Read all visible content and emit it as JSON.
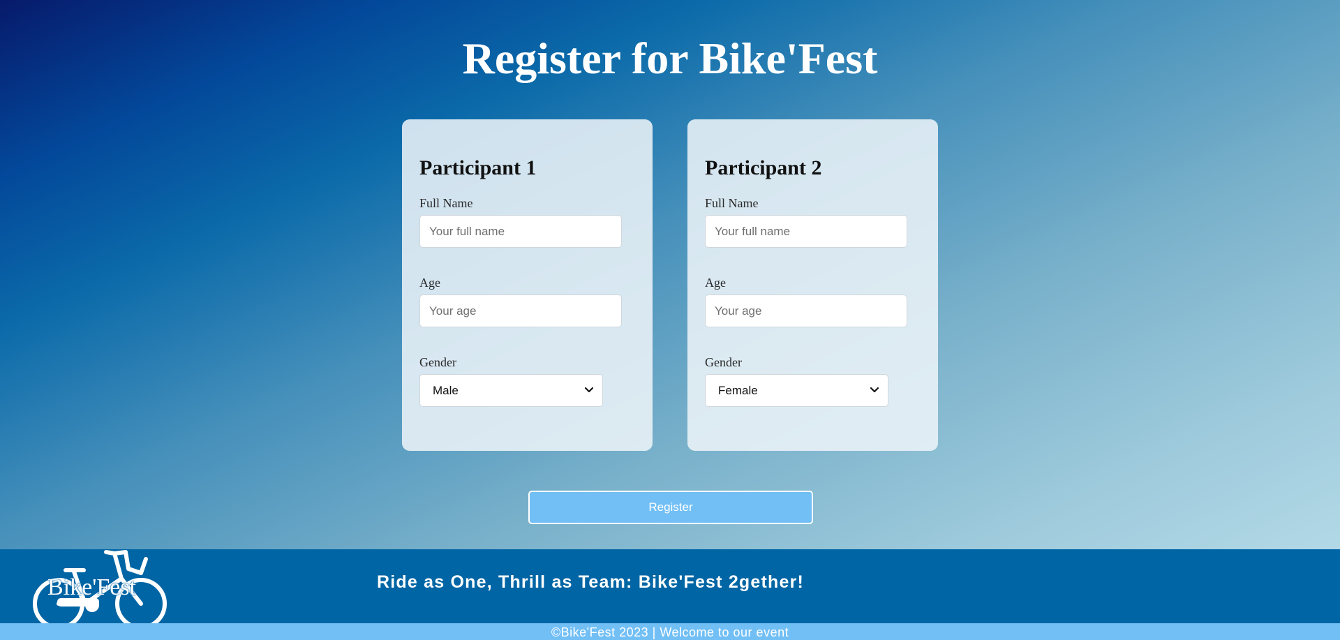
{
  "page": {
    "title": "Register for Bike'Fest"
  },
  "participants": [
    {
      "heading": "Participant 1",
      "full_name": {
        "label": "Full Name",
        "placeholder": "Your full name",
        "value": ""
      },
      "age": {
        "label": "Age",
        "placeholder": "Your age",
        "value": ""
      },
      "gender": {
        "label": "Gender",
        "selected": "Male"
      }
    },
    {
      "heading": "Participant 2",
      "full_name": {
        "label": "Full Name",
        "placeholder": "Your full name",
        "value": ""
      },
      "age": {
        "label": "Age",
        "placeholder": "Your age",
        "value": ""
      },
      "gender": {
        "label": "Gender",
        "selected": "Female"
      }
    }
  ],
  "register_button": {
    "label": "Register"
  },
  "footer": {
    "logo_text": "Bike'Fest",
    "tagline": "Ride as One, Thrill as Team: Bike'Fest 2gether!",
    "copyright": "©Bike'Fest 2023 | Welcome to our event"
  },
  "colors": {
    "footer_bg": "#0065a4",
    "button_bg": "#72bff5",
    "card_bg": "#edf3f8"
  },
  "icons": [
    "chevron-down-icon",
    "bicycle-icon"
  ]
}
